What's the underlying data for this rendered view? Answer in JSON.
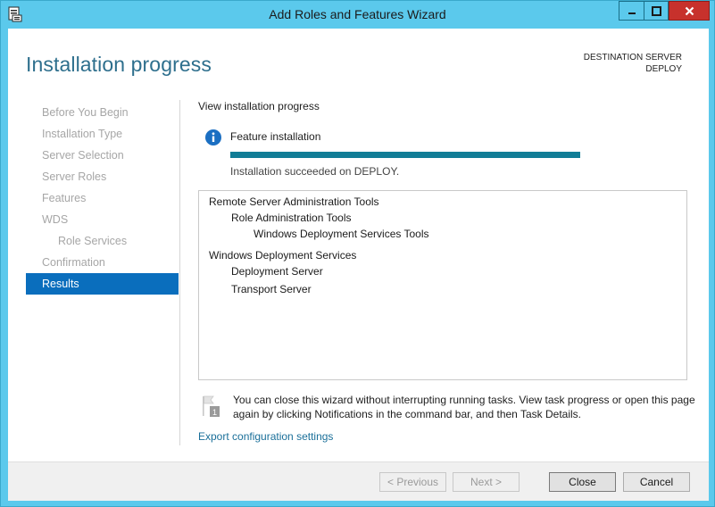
{
  "window": {
    "title": "Add Roles and Features Wizard"
  },
  "header": {
    "page_title": "Installation progress",
    "destination_label": "DESTINATION SERVER",
    "destination_server": "DEPLOY"
  },
  "nav": {
    "items": [
      {
        "label": "Before You Begin",
        "state": "disabled"
      },
      {
        "label": "Installation Type",
        "state": "disabled"
      },
      {
        "label": "Server Selection",
        "state": "disabled"
      },
      {
        "label": "Server Roles",
        "state": "disabled"
      },
      {
        "label": "Features",
        "state": "disabled"
      },
      {
        "label": "WDS",
        "state": "disabled"
      },
      {
        "label": "Role Services",
        "state": "disabled"
      },
      {
        "label": "Confirmation",
        "state": "disabled"
      },
      {
        "label": "Results",
        "state": "active"
      }
    ]
  },
  "main": {
    "heading": "View installation progress",
    "feature_label": "Feature installation",
    "progress": 1.0,
    "status": "Installation succeeded on DEPLOY.",
    "results": [
      "Remote Server Administration Tools",
      "Role Administration Tools",
      "Windows Deployment Services Tools",
      "Windows Deployment Services",
      "Deployment Server",
      "Transport Server"
    ],
    "note": "You can close this wizard without interrupting running tasks. View task progress or open this page again by clicking Notifications in the command bar, and then Task Details.",
    "export_link": "Export configuration settings"
  },
  "footer": {
    "previous": "< Previous",
    "next": "Next >",
    "close": "Close",
    "cancel": "Cancel"
  },
  "colors": {
    "accent": "#0a6ebd",
    "title_bar": "#5bc9ec",
    "progress": "#117d96",
    "close_button": "#c7312c",
    "page_title": "#2e6f8d"
  }
}
